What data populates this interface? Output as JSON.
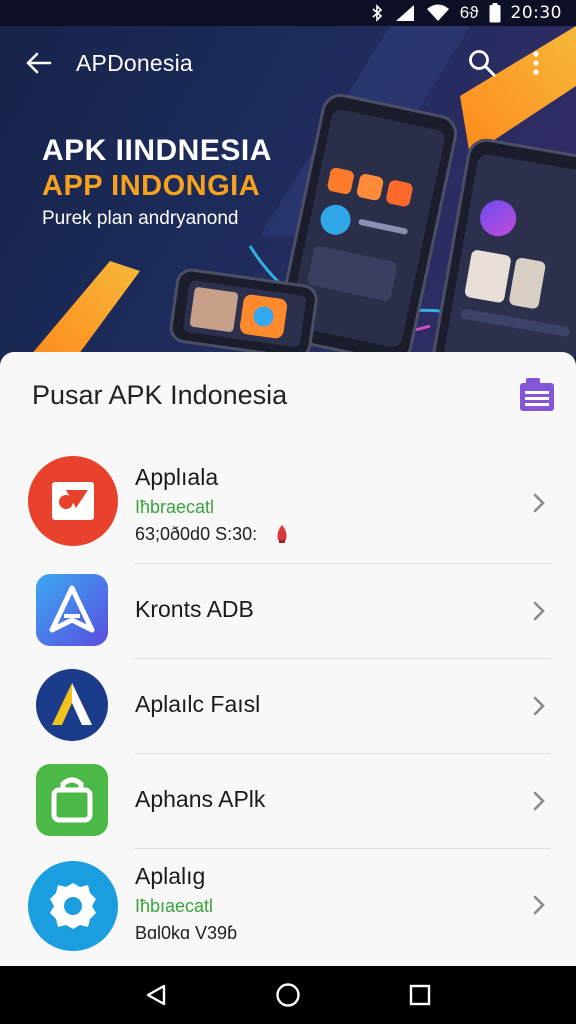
{
  "status_bar": {
    "icons": [
      "bluetooth-icon",
      "signal-icon",
      "wifi-icon",
      "battery-icon"
    ],
    "network_label": "6ϑ",
    "time": "20:30"
  },
  "app_bar": {
    "title": "APDonesia",
    "back_icon": "arrow-left-icon",
    "search_icon": "search-icon",
    "menu_icon": "more-vert-icon"
  },
  "hero": {
    "title_line1": "APK IINDNESIA",
    "title_line2": "APP INDONGIA",
    "subtitle": "Purek plan andryanond",
    "colors": {
      "accent": "#f7a21c",
      "background": "#1c2b5a"
    }
  },
  "sheet": {
    "title": "Pusar APK Indonesia",
    "icon": "catalog-icon",
    "items": [
      {
        "name": "Applıala",
        "sub1": "Iħbraecatl",
        "sub2": "63;0ð0d0 S:30:",
        "icon": "record-app-icon",
        "icon_color": "#e8412c",
        "badge_icon": "rocket-icon"
      },
      {
        "name": "Kronts ADB",
        "icon": "a-logo-app-icon",
        "icon_color": "#3a7fe8"
      },
      {
        "name": "Aplaılc Faısl",
        "icon": "triangle-logo-app-icon",
        "icon_color": "#1b3c8a"
      },
      {
        "name": "Aphans APlk",
        "icon": "bag-app-icon",
        "icon_color": "#4cb848"
      },
      {
        "name": "Aplalıg",
        "sub1": "Iħbıaecatl",
        "sub2": "Bɑl0kɑ V39ɓ",
        "icon": "gear-app-icon",
        "icon_color": "#1a9ee0"
      }
    ]
  },
  "nav_bar": {
    "icons": [
      "nav-back-icon",
      "nav-home-icon",
      "nav-recents-icon"
    ]
  }
}
